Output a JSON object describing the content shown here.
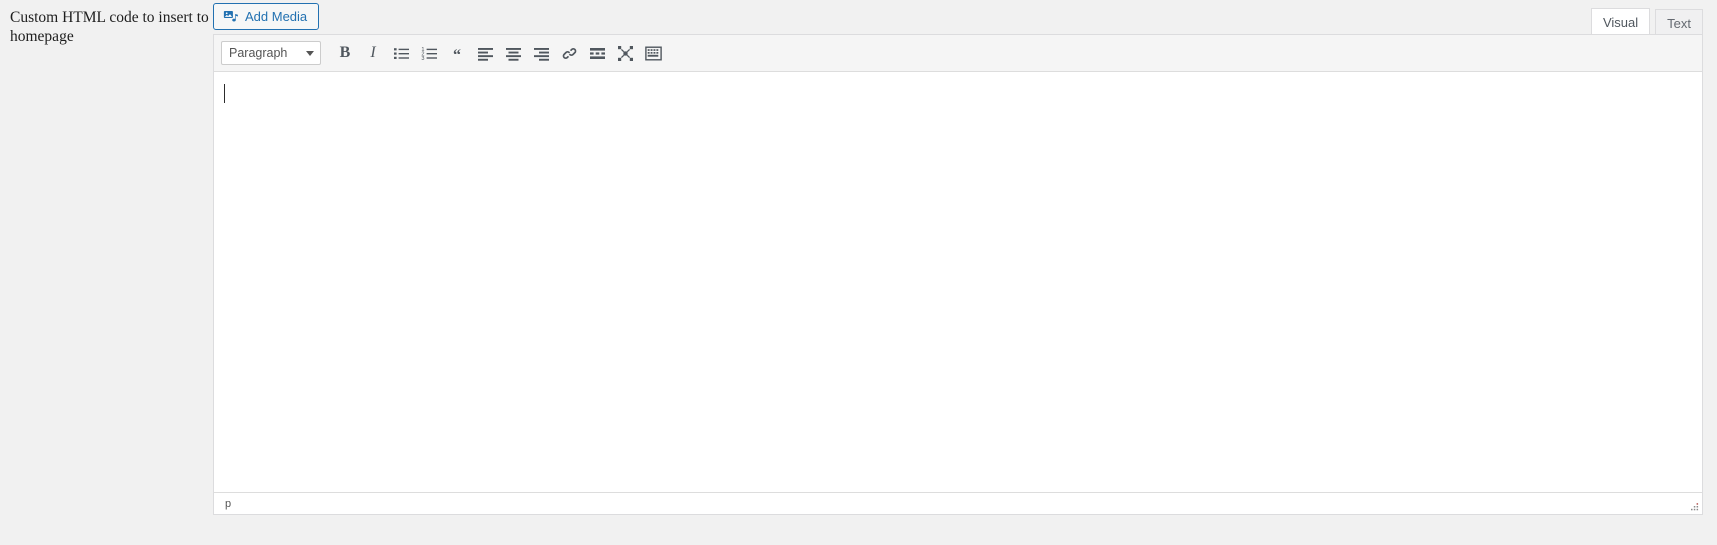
{
  "field": {
    "label": "Custom HTML code to insert to homepage"
  },
  "toolbar_top": {
    "add_media_label": "Add Media",
    "add_media_icon": "media-add-icon"
  },
  "editor_tabs": [
    {
      "label": "Visual",
      "active": true
    },
    {
      "label": "Text",
      "active": false
    }
  ],
  "format_select": {
    "value": "Paragraph",
    "caret_icon": "chevron-down-icon"
  },
  "toolbar_buttons": [
    {
      "name": "bold-button",
      "label": "B",
      "icon": "bold-icon"
    },
    {
      "name": "italic-button",
      "label": "I",
      "icon": "italic-icon"
    },
    {
      "name": "bullet-list-button",
      "label": "",
      "icon": "unordered-list-icon"
    },
    {
      "name": "numbered-list-button",
      "label": "",
      "icon": "ordered-list-icon"
    },
    {
      "name": "blockquote-button",
      "label": "“",
      "icon": "blockquote-icon"
    },
    {
      "name": "align-left-button",
      "label": "",
      "icon": "align-left-icon"
    },
    {
      "name": "align-center-button",
      "label": "",
      "icon": "align-center-icon"
    },
    {
      "name": "align-right-button",
      "label": "",
      "icon": "align-right-icon"
    },
    {
      "name": "insert-link-button",
      "label": "",
      "icon": "link-icon"
    },
    {
      "name": "read-more-button",
      "label": "",
      "icon": "insert-more-icon"
    },
    {
      "name": "fullscreen-button",
      "label": "",
      "icon": "fullscreen-icon"
    },
    {
      "name": "toolbar-toggle-button",
      "label": "",
      "icon": "keyboard-toolbar-toggle-icon"
    }
  ],
  "content": {
    "text": "",
    "cursor_visible": true
  },
  "statusbar": {
    "element_path": "p",
    "resize_icon": "resize-handle-icon"
  },
  "colors": {
    "accent_blue": "#2271b1",
    "page_bg": "#f1f1f1",
    "toolbar_bg": "#f5f5f5",
    "border": "#dcdcde",
    "icon": "#50575e",
    "text": "#1d1d1d"
  }
}
